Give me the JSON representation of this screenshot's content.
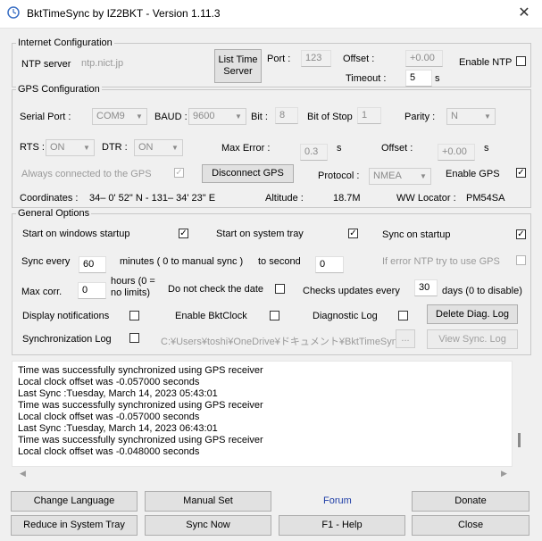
{
  "window": {
    "title": "BktTimeSync by IZ2BKT - Version 1.11.3",
    "close_glyph": "✕"
  },
  "internet": {
    "legend": "Internet Configuration",
    "ntp_server_label": "NTP server",
    "ntp_server_value": "ntp.nict.jp",
    "list_time_server_button": "List Time Server",
    "port_label": "Port :",
    "port_value": "123",
    "offset_label": "Offset :",
    "offset_value": "+0.00",
    "timeout_label": "Timeout :",
    "timeout_value": "5",
    "timeout_unit": "s",
    "enable_ntp_label": "Enable NTP"
  },
  "gps": {
    "legend": "GPS Configuration",
    "serial_port_label": "Serial Port :",
    "serial_port_value": "COM9",
    "baud_label": "BAUD :",
    "baud_value": "9600",
    "bit_label": "Bit :",
    "bit_value": "8",
    "bit_of_stop_label": "Bit of Stop",
    "bit_of_stop_value": "1",
    "parity_label": "Parity :",
    "parity_value": "N",
    "rts_label": "RTS :",
    "rts_value": "ON",
    "dtr_label": "DTR :",
    "dtr_value": "ON",
    "max_error_label": "Max Error :",
    "max_error_value": "0.3",
    "max_error_unit": "s",
    "offset_label": "Offset :",
    "offset_value": "+0.00",
    "offset_unit": "s",
    "always_connected_label": "Always connected to the GPS",
    "disconnect_button": "Disconnect GPS",
    "protocol_label": "Protocol :",
    "protocol_value": "NMEA",
    "enable_gps_label": "Enable GPS",
    "coordinates_label": "Coordinates :",
    "coordinates_value": "34– 0' 52\" N - 131– 34' 23\" E",
    "altitude_label": "Altitude :",
    "altitude_value": "18.7M",
    "ww_locator_label": "WW Locator :",
    "ww_locator_value": "PM54SA"
  },
  "general": {
    "legend": "General Options",
    "start_windows_label": "Start on windows startup",
    "start_tray_label": "Start on system tray",
    "sync_startup_label": "Sync on startup",
    "sync_every_label": "Sync every",
    "sync_every_value": "60",
    "minutes_label": "minutes ( 0 to manual sync )",
    "to_second_label": "to second",
    "to_second_value": "0",
    "if_error_ntp_label": "If error NTP try to use GPS",
    "max_corr_label": "Max corr.",
    "max_corr_value": "0",
    "hours_label_1": "hours (0 =",
    "hours_label_2": "no limits)",
    "no_check_date_label": "Do not check the date",
    "checks_updates_label": "Checks updates every",
    "checks_updates_value": "30",
    "days_label": "days (0 to disable)",
    "display_notifications_label": "Display notifications",
    "enable_bktclock_label": "Enable BktClock",
    "diagnostic_log_label": "Diagnostic Log",
    "delete_diag_button": "Delete Diag. Log",
    "sync_log_label": "Synchronization Log",
    "sync_log_path": "C:¥Users¥toshi¥OneDrive¥ドキュメント¥BktTimeSyncL",
    "browse_button": "...",
    "view_sync_button": "View Sync. Log"
  },
  "log": [
    "Time was successfully synchronized using GPS receiver",
    "Local clock offset was -0.057000 seconds",
    "Last Sync :Tuesday, March 14, 2023 05:43:01",
    "Time was successfully synchronized using GPS receiver",
    "Local clock offset was -0.057000 seconds",
    "Last Sync :Tuesday, March 14, 2023 06:43:01",
    "Time was successfully synchronized using GPS receiver",
    "Local clock offset was -0.048000 seconds"
  ],
  "buttons": {
    "change_language": "Change Language",
    "manual_set": "Manual Set",
    "forum": "Forum",
    "donate": "Donate",
    "reduce_tray": "Reduce in System Tray",
    "sync_now": "Sync Now",
    "help": "F1 - Help",
    "close": "Close"
  }
}
